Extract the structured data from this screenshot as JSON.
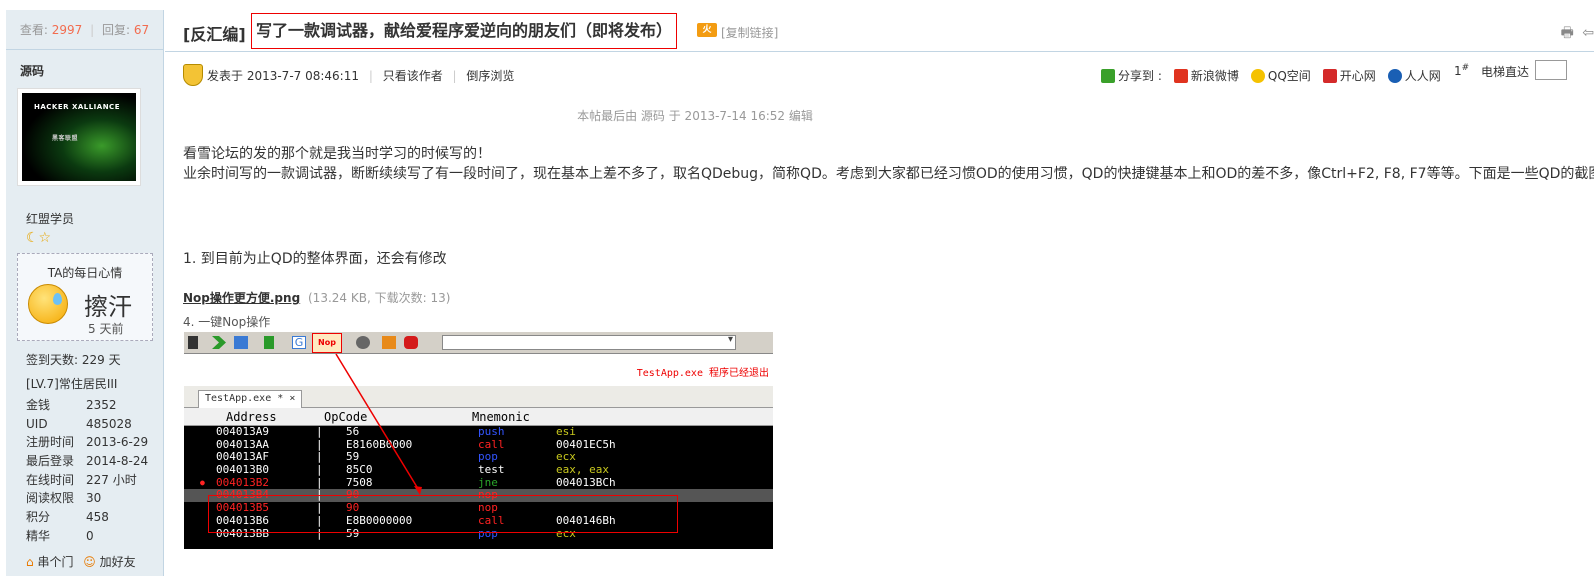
{
  "sidebar": {
    "views_label": "查看:",
    "views": "2997",
    "replies_label": "回复:",
    "replies": "67",
    "author": "源码",
    "avatar_text": "HACKER XALLIANCE",
    "avatar_subtext": "黑客联盟",
    "group": "红盟学员",
    "mood_title": "TA的每日心情",
    "mood_word": "擦汗",
    "mood_time": "5 天前",
    "sign_days": "签到天数: 229 天",
    "level": "[LV.7]常住居民III",
    "stats": [
      {
        "label": "金钱",
        "value": "2352"
      },
      {
        "label": "UID",
        "value": "485028"
      },
      {
        "label": "注册时间",
        "value": "2013-6-29"
      },
      {
        "label": "最后登录",
        "value": "2014-8-24"
      },
      {
        "label": "在线时间",
        "value": "227 小时"
      },
      {
        "label": "阅读权限",
        "value": "30"
      },
      {
        "label": "积分",
        "value": "458"
      },
      {
        "label": "精华",
        "value": "0"
      }
    ],
    "visit_label": "串个门",
    "add_friend_label": "加好友"
  },
  "header": {
    "category": "[反汇编]",
    "title": "写了一款调试器，献给爱程序爱逆向的朋友们（即将发布）",
    "hot_badge": "火",
    "copy_link": "[复制链接]"
  },
  "postinfo": {
    "posted": "发表于 2013-7-7 08:46:11",
    "only_author": "只看该作者",
    "reverse": "倒序浏览",
    "share_label": "分享到 :",
    "share_targets": [
      "新浪微博",
      "QQ空间",
      "开心网",
      "人人网"
    ],
    "floor": "1",
    "floor_sup": "#",
    "elevator": "电梯直达"
  },
  "post": {
    "edited": "本帖最后由 源码 于 2013-7-14 16:52 编辑",
    "line1": "看雪论坛的发的那个就是我当时学习的时候写的！",
    "line2": "业余时间写的一款调试器，断断续续写了有一段时间了，现在基本上差不多了，取名QDebug，简称QD。考虑到大家都已经习惯OD的使用习惯，QD的快捷键基本上和OD的差不多，像Ctrl+F2, F8, F7等等。下面是一些QD的截图",
    "step1": "1. 到目前为止QD的整体界面，还会有修改",
    "attachment_name": "Nop操作更方便.png",
    "attachment_meta": "(13.24 KB, 下载次数: 13)",
    "caption": "4. 一键Nop操作"
  },
  "screenshot": {
    "nop_button": "Nop",
    "status_text": "TestApp.exe 程序已经退出",
    "tab_label": "TestApp.exe *",
    "tab_close": "×",
    "columns": [
      "Address",
      "OpCode",
      "Mnemonic"
    ],
    "rows": [
      {
        "addr": "004013A9",
        "code": "56",
        "mn": "push",
        "op": "esi"
      },
      {
        "addr": "004013AA",
        "code": "E8160B0000",
        "mn": "call",
        "op": "00401EC5h"
      },
      {
        "addr": "004013AF",
        "code": "59",
        "mn": "pop",
        "op": "ecx"
      },
      {
        "addr": "004013B0",
        "code": "85C0",
        "mn": "test",
        "op": "eax, eax"
      },
      {
        "addr": "004013B2",
        "code": "7508",
        "mn": "jne",
        "op": "004013BCh"
      },
      {
        "addr": "004013B4",
        "code": "90",
        "mn": "nop",
        "op": ""
      },
      {
        "addr": "004013B5",
        "code": "90",
        "mn": "nop",
        "op": ""
      },
      {
        "addr": "004013B6",
        "code": "E8B0000000",
        "mn": "call",
        "op": "0040146Bh"
      },
      {
        "addr": "004013BB",
        "code": "59",
        "mn": "pop",
        "op": "ecx"
      }
    ],
    "colors": {
      "addr": "#ffffff",
      "code": "#ffffff",
      "push_pop": "#3355ff",
      "call": "#ff2222",
      "test": "#ffffff",
      "jne": "#2aa52a",
      "operand": "#c8c81e",
      "nop": "#ff2222",
      "bp": "#ff2222"
    }
  }
}
